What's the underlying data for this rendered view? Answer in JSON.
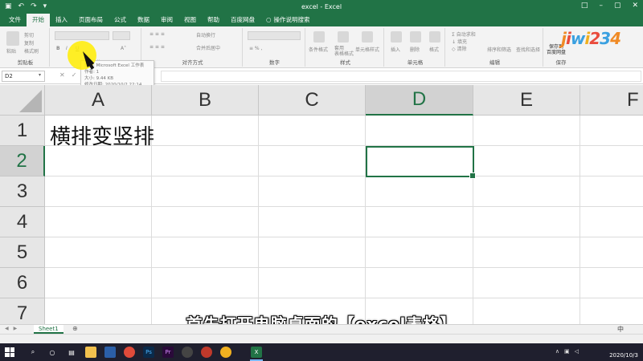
{
  "window": {
    "title": "excel - Excel",
    "user": "",
    "qat_icons": [
      "save-icon",
      "undo-icon",
      "redo-icon"
    ]
  },
  "ribbon_tabs": [
    {
      "label": "文件",
      "active": false
    },
    {
      "label": "开始",
      "active": true
    },
    {
      "label": "插入",
      "active": false
    },
    {
      "label": "页面布局",
      "active": false
    },
    {
      "label": "公式",
      "active": false
    },
    {
      "label": "数据",
      "active": false
    },
    {
      "label": "审阅",
      "active": false
    },
    {
      "label": "视图",
      "active": false
    },
    {
      "label": "帮助",
      "active": false
    },
    {
      "label": "百度网盘",
      "active": false
    }
  ],
  "tell_me": "操作说明搜索",
  "ribbon": {
    "clipboard": {
      "paste": "粘贴",
      "cut": "剪切",
      "copy": "复制",
      "format_painter": "格式刷",
      "label": "剪贴板"
    },
    "font": {
      "label": "字体",
      "bold": "B",
      "italic": "I",
      "underline": "U"
    },
    "alignment": {
      "wrap": "自动换行",
      "merge": "合并后居中",
      "label": "对齐方式"
    },
    "number": {
      "label": "数字"
    },
    "styles": {
      "conditional": "条件格式",
      "table": "套用\n表格格式",
      "cell_styles": "单元格样式",
      "label": "样式"
    },
    "cells": {
      "insert": "插入",
      "delete": "删除",
      "format": "格式",
      "label": "单元格"
    },
    "editing": {
      "autosum": "自动求和",
      "fill": "填充",
      "clear": "清除",
      "sort": "排序和筛选",
      "find": "查找和选择",
      "label": "编辑"
    },
    "save": {
      "save_to": "保存到\n百度网盘",
      "label": "保存"
    }
  },
  "logo_text": "jiwi234",
  "formula_bar": {
    "name_box": "D2",
    "cancel_icon": "✕",
    "enter_icon": "✓",
    "fx": "fx"
  },
  "tooltip": {
    "line1": "类型: Microsoft Excel 工作表",
    "line2": "作者: 1",
    "line3": "大小: 9.44 KB",
    "line4": "修改日期: 2020/10/2 22:14"
  },
  "grid": {
    "columns": [
      "A",
      "B",
      "C",
      "D",
      "E",
      "F"
    ],
    "rows": [
      "1",
      "2",
      "3",
      "4",
      "5",
      "6",
      "7"
    ],
    "selected_column": "D",
    "selected_row": "2",
    "cells": {
      "A1": "横排变竖排"
    }
  },
  "caption": "首先打开电脑桌面的【excel表格】",
  "sheets": [
    {
      "name": "Sheet1",
      "active": true
    }
  ],
  "ime": "中",
  "taskbar": {
    "date": "2020/10/3",
    "apps": [
      "search-icon",
      "cortana-icon",
      "task-view-icon",
      "explorer-icon",
      "chrome-icon",
      "photoshop-icon",
      "premiere-icon",
      "camtasia-icon",
      "record-icon",
      "media-icon",
      "excel-icon"
    ]
  },
  "colors": {
    "excel_green": "#217346",
    "taskbar": "#1f1f2e",
    "cursor_highlight": "#ffec00"
  }
}
